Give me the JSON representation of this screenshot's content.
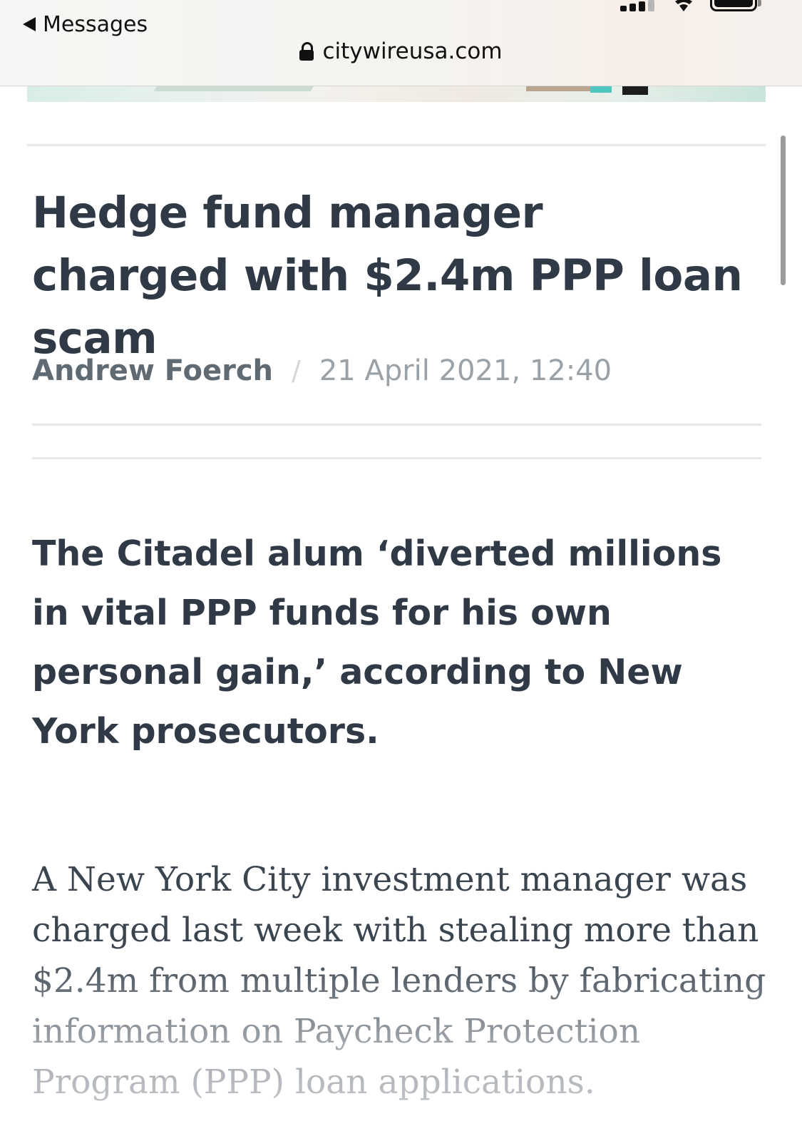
{
  "browser": {
    "back_label": "Messages",
    "url": "citywireusa.com"
  },
  "status_icons": [
    "cellular-signal-icon",
    "wifi-icon",
    "battery-icon"
  ],
  "article": {
    "headline": "Hedge fund manager charged with $2.4m PPP loan scam",
    "author": "Andrew Foerch",
    "separator": "/",
    "timestamp": "21 April 2021, 12:40",
    "standfirst": "The Citadel alum ‘diverted millions in vital PPP funds for his own personal gain,’ according to New York prosecutors.",
    "body_first_paragraph": "A New York City investment manager was charged last week with stealing more than $2.4m from multiple lenders by fabricating information on Paycheck Protection Program (PPP) loan applications."
  },
  "colors": {
    "headline": "#2f3a46",
    "author": "#5f6a73",
    "timestamp": "#9aa2a8",
    "divider": "#e6e8ea",
    "body": "#3a4550"
  }
}
